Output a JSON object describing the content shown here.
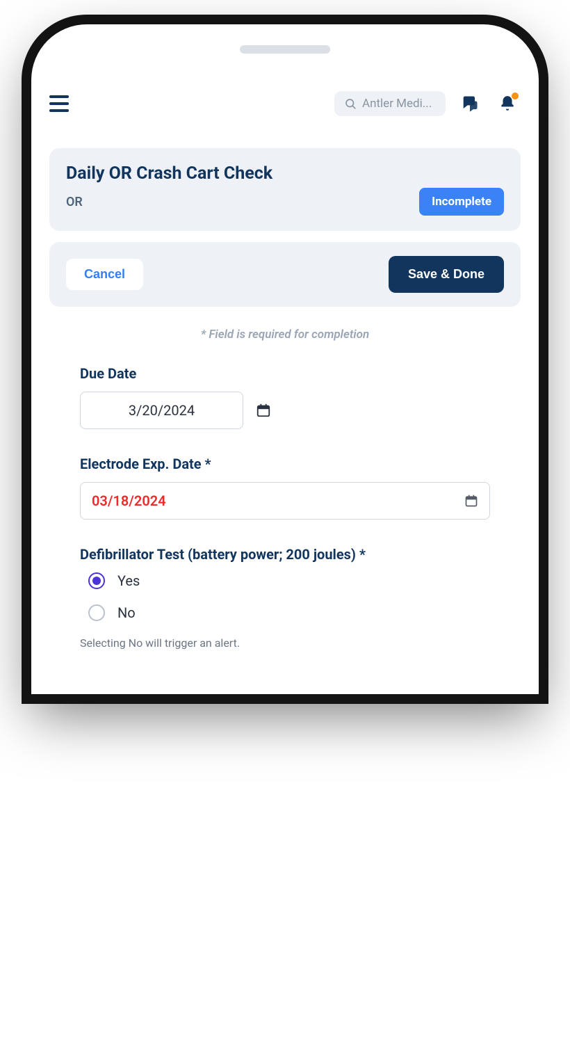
{
  "topbar": {
    "search_placeholder": "Antler Medi..."
  },
  "header": {
    "title": "Daily OR Crash Cart Check",
    "subtitle": "OR",
    "status_label": "Incomplete"
  },
  "actions": {
    "cancel_label": "Cancel",
    "save_label": "Save & Done"
  },
  "form": {
    "required_hint": "* Field is required for completion",
    "due_date": {
      "label": "Due Date",
      "value": "3/20/2024"
    },
    "electrode_exp": {
      "label": "Electrode Exp. Date *",
      "value": "03/18/2024"
    },
    "defib_test": {
      "label": "Defibrillator Test (battery power; 200 joules) *",
      "options": {
        "yes": "Yes",
        "no": "No"
      },
      "selected": "yes",
      "note": "Selecting No will trigger an alert."
    }
  }
}
